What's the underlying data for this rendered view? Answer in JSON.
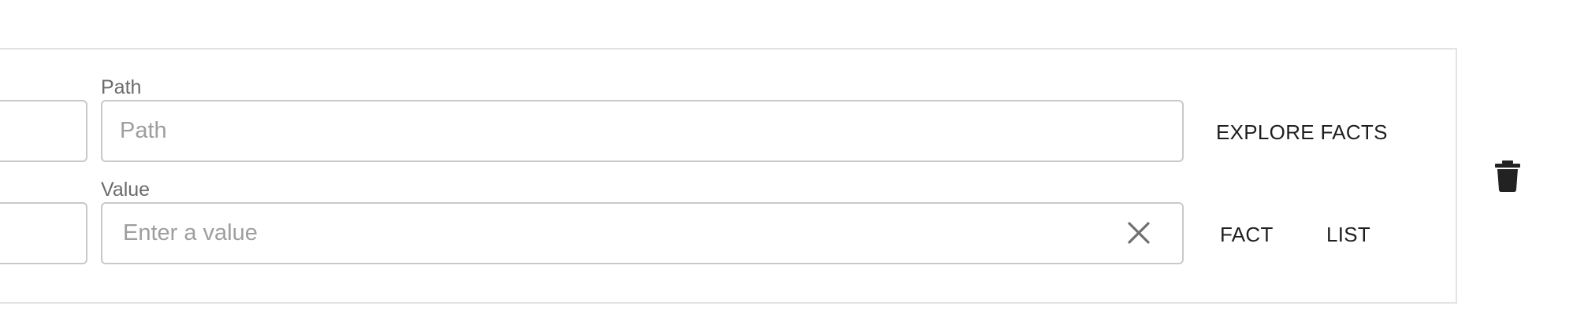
{
  "path_field": {
    "label": "Path",
    "placeholder": "Path",
    "value": ""
  },
  "value_field": {
    "label": "Value",
    "placeholder": "Enter a value",
    "value": ""
  },
  "actions": {
    "explore_facts": "EXPLORE FACTS",
    "fact": "FACT",
    "list": "LIST"
  },
  "icons": {
    "clear": "close-icon",
    "delete": "trash-icon"
  },
  "colors": {
    "border": "#c9c9c9",
    "card_border": "#e3e3e3",
    "label": "#6b6b6b",
    "placeholder": "#9e9e9e",
    "button_text": "#1f1f1f"
  }
}
